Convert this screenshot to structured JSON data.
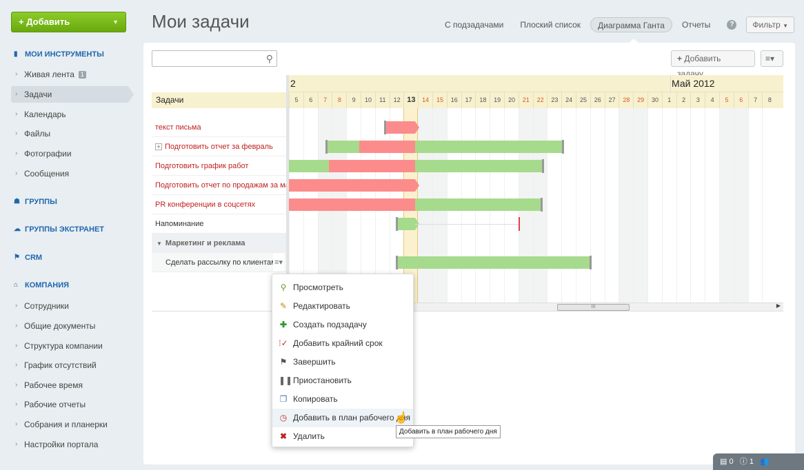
{
  "app": {
    "add_label": "Добавить",
    "page_title": "Мои задачи"
  },
  "sidebar": {
    "sections": {
      "tools": "МОИ ИНСТРУМЕНТЫ",
      "groups": "ГРУППЫ",
      "extranet": "ГРУППЫ ЭКСТРАНЕТ",
      "crm": "CRM",
      "company": "КОМПАНИЯ"
    },
    "tools_items": [
      {
        "label": "Живая лента",
        "badge": "1"
      },
      {
        "label": "Задачи"
      },
      {
        "label": "Календарь"
      },
      {
        "label": "Файлы"
      },
      {
        "label": "Фотографии"
      },
      {
        "label": "Сообщения"
      }
    ],
    "company_items": [
      {
        "label": "Сотрудники"
      },
      {
        "label": "Общие документы"
      },
      {
        "label": "Структура компании"
      },
      {
        "label": "График отсутствий"
      },
      {
        "label": "Рабочее время"
      },
      {
        "label": "Рабочие отчеты"
      },
      {
        "label": "Собрания и планерки"
      },
      {
        "label": "Настройки портала"
      }
    ]
  },
  "view_tabs": [
    "С подзадачами",
    "Плоский список",
    "Диаграмма Ганта",
    "Отчеты"
  ],
  "active_tab": "Диаграмма Ганта",
  "help_label": "?",
  "filter_label": "Фильтр",
  "toolbar": {
    "add_task_label": "Добавить задачу",
    "search_placeholder": ""
  },
  "gantt": {
    "tasks_header": "Задачи",
    "month_prev": "2",
    "month_next": "Май 2012",
    "days": [
      "5",
      "6",
      "7",
      "8",
      "9",
      "10",
      "11",
      "12",
      "13",
      "14",
      "15",
      "16",
      "17",
      "18",
      "19",
      "20",
      "21",
      "22",
      "23",
      "24",
      "25",
      "26",
      "27",
      "28",
      "29",
      "30",
      "1",
      "2",
      "3",
      "4",
      "5",
      "6",
      "7",
      "8"
    ],
    "weekend_days": [
      2,
      3,
      9,
      10,
      16,
      17,
      23,
      24,
      30,
      31
    ],
    "today_index": 8,
    "tasks": [
      {
        "name": "текст письма",
        "style": "red"
      },
      {
        "name": "Подготовить отчет за февраль",
        "style": "red",
        "expand": "+"
      },
      {
        "name": "Подготовить график работ",
        "style": "red"
      },
      {
        "name": "Подготовить отчет по продажам за март",
        "style": "red"
      },
      {
        "name": "PR конференции в соцсетях",
        "style": "red"
      },
      {
        "name": "Напоминание",
        "style": "normal"
      },
      {
        "name": "Маркетинг и реклама",
        "style": "group"
      },
      {
        "name": "Сделать рассылку по клиентам",
        "style": "sub"
      }
    ],
    "bars": [
      {
        "row": 0,
        "segments": [
          {
            "color": "red",
            "from": 6.7,
            "to": 8.8
          }
        ],
        "arrow": true
      },
      {
        "row": 1,
        "segments": [
          {
            "color": "green",
            "from": 2.6,
            "to": 4.9
          },
          {
            "color": "red",
            "from": 4.9,
            "to": 8.8
          },
          {
            "color": "green",
            "from": 8.8,
            "to": 19.1
          }
        ]
      },
      {
        "row": 2,
        "segments": [
          {
            "color": "green",
            "from": 0,
            "to": 2.8
          },
          {
            "color": "red",
            "from": 2.8,
            "to": 8.8
          },
          {
            "color": "green",
            "from": 8.8,
            "to": 17.7
          }
        ]
      },
      {
        "row": 3,
        "segments": [
          {
            "color": "red",
            "from": 0,
            "to": 8.8
          }
        ],
        "arrow": true
      },
      {
        "row": 4,
        "segments": [
          {
            "color": "red",
            "from": 0,
            "to": 8.8
          },
          {
            "color": "green",
            "from": 8.8,
            "to": 17.6
          }
        ]
      },
      {
        "row": 5,
        "segments": [
          {
            "color": "green",
            "from": 7.5,
            "to": 8.8
          }
        ],
        "arrow": true,
        "deadline": 16.0
      },
      {
        "row": 7,
        "segments": [
          {
            "color": "green",
            "from": 7.5,
            "to": 21.0
          }
        ]
      }
    ]
  },
  "context_menu": {
    "items": [
      {
        "label": "Просмотреть",
        "icon": "magnifier-icon"
      },
      {
        "label": "Редактировать",
        "icon": "pencil-icon"
      },
      {
        "label": "Создать подзадачу",
        "icon": "plus-icon"
      },
      {
        "label": "Добавить крайний срок",
        "icon": "deadline-icon"
      },
      {
        "label": "Завершить",
        "icon": "flag-icon"
      },
      {
        "label": "Приостановить",
        "icon": "pause-icon"
      },
      {
        "label": "Копировать",
        "icon": "copy-icon"
      },
      {
        "label": "Добавить в план рабочего дня",
        "icon": "clock-icon"
      },
      {
        "label": "Удалить",
        "icon": "delete-icon"
      }
    ],
    "tooltip": "Добавить в план рабочего дня"
  },
  "bottom_bar": {
    "messages_count": "0",
    "notifications_count": "1"
  },
  "colors": {
    "green_bar": "#a6da8c",
    "red_bar": "#fc8b8b",
    "accent": "#2067b0",
    "today": "#fbf1cf"
  }
}
